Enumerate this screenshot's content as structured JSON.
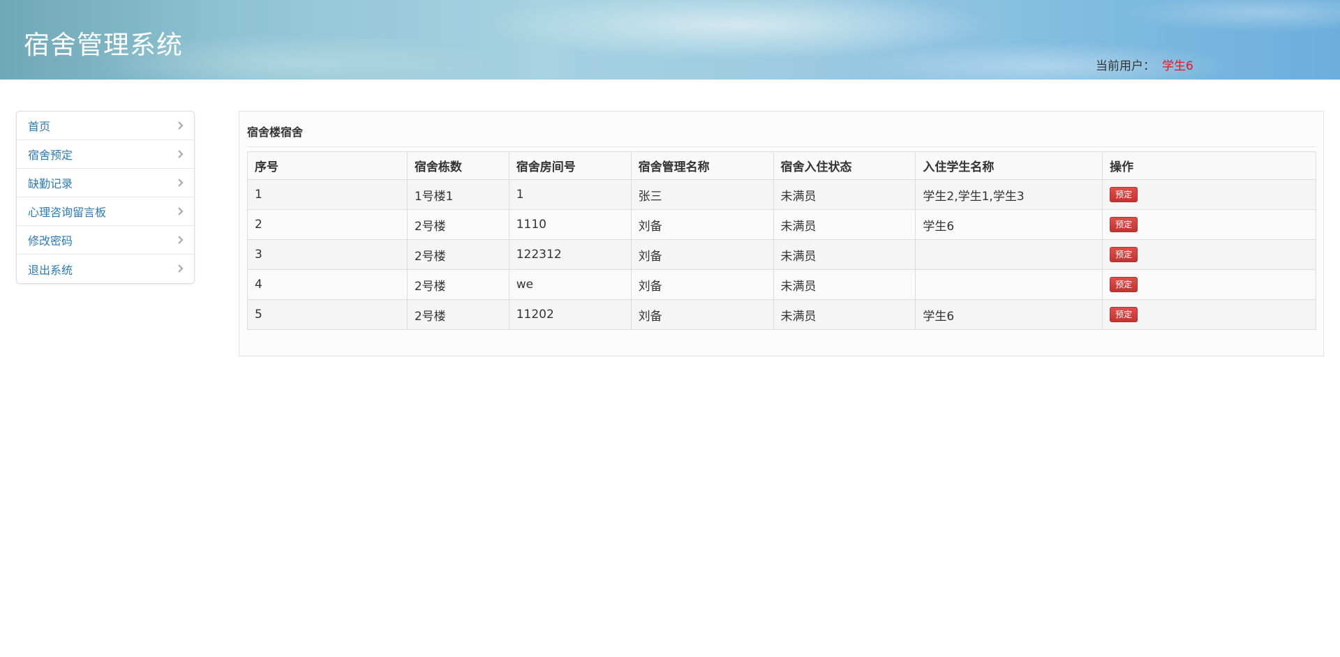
{
  "header": {
    "title": "宿舍管理系统",
    "current_user_label": "当前用户：",
    "current_user_name": "学生6"
  },
  "sidebar": {
    "items": [
      {
        "label": "首页"
      },
      {
        "label": "宿舍预定"
      },
      {
        "label": "缺勤记录"
      },
      {
        "label": "心理咨询留言板"
      },
      {
        "label": "修改密码"
      },
      {
        "label": "退出系统"
      }
    ]
  },
  "panel": {
    "title": "宿舍楼宿舍",
    "columns": [
      "序号",
      "宿舍栋数",
      "宿舍房间号",
      "宿舍管理名称",
      "宿舍入住状态",
      "入住学生名称",
      "操作"
    ],
    "rows": [
      {
        "no": "1",
        "building": "1号楼1",
        "room": "1",
        "manager": "张三",
        "status": "未满员",
        "students": "学生2,学生1,学生3",
        "action": "预定"
      },
      {
        "no": "2",
        "building": "2号楼",
        "room": "1110",
        "manager": "刘备",
        "status": "未满员",
        "students": "学生6",
        "action": "预定"
      },
      {
        "no": "3",
        "building": "2号楼",
        "room": "122312",
        "manager": "刘备",
        "status": "未满员",
        "students": "",
        "action": "预定"
      },
      {
        "no": "4",
        "building": "2号楼",
        "room": "we",
        "manager": "刘备",
        "status": "未满员",
        "students": "",
        "action": "预定"
      },
      {
        "no": "5",
        "building": "2号楼",
        "room": "11202",
        "manager": "刘备",
        "status": "未满员",
        "students": "学生6",
        "action": "预定"
      }
    ]
  },
  "colors": {
    "link": "#2a7bb8",
    "user_name": "#e8141e",
    "reserve_button": "#cc3a37"
  }
}
